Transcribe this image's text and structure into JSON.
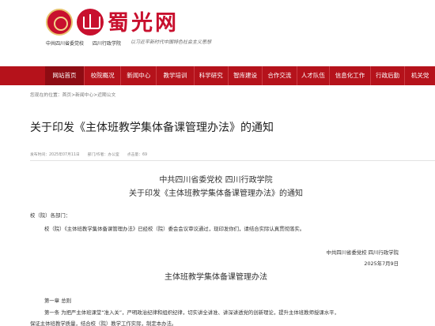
{
  "header": {
    "brand": "蜀光网",
    "sub_left": "中共四川省委党校",
    "sub_right": "四川行政学院",
    "slogan": "以习近平新时代中国特色社会主义思想"
  },
  "nav": {
    "items": [
      {
        "label": "网站首页",
        "active": true
      },
      {
        "label": "校院概况",
        "active": false
      },
      {
        "label": "新闻中心",
        "active": false
      },
      {
        "label": "教学培训",
        "active": false
      },
      {
        "label": "科学研究",
        "active": false
      },
      {
        "label": "智库建设",
        "active": false
      },
      {
        "label": "合作交流",
        "active": false
      },
      {
        "label": "人才队伍",
        "active": false
      },
      {
        "label": "信息化工作",
        "active": false
      },
      {
        "label": "行政后勤",
        "active": false
      },
      {
        "label": "机关党",
        "active": false
      }
    ]
  },
  "breadcrumb": {
    "prefix": "您现在的位置：",
    "home": "首页",
    "sep1": ">",
    "section": "新闻中心",
    "sep2": ">",
    "current": "近期公文"
  },
  "article": {
    "title": "关于印发《主体班教学集体备课管理办法》的通知",
    "meta": {
      "published": "发布时间：2025年07月11日",
      "dept": "部门/作者：办公室",
      "views": "点击量：69"
    },
    "body": {
      "org_line": "中共四川省委党校 四川行政学院",
      "notice_title": "关于印发《主体班教学集体备课管理办法》的通知",
      "salutation": "校（院）各部门：",
      "para1": "校（院）《主体班教学集体备课管理办法》已经校（院）委会会议审议通过，现印发你们，请结合实际认真贯彻落实。",
      "signature_org": "中共四川省委党校 四川行政学院",
      "signature_date": "2025年7月9日",
      "doc_title": "主体班教学集体备课管理办法",
      "chapter1": "第一章  总则",
      "art1_line1": "第一条  为把严主体班课堂“准入关”，严明政治纪律和组织纪律，切实讲全讲准、讲深讲透党的创新理论，提升主体班教师授课水平，",
      "art1_line2": "保证主体班教学质量，结合校（院）教学工作实际，制定本办法。"
    }
  },
  "colors": {
    "brand_red": "#c8102e",
    "nav_red": "#b5121b",
    "nav_active": "#8e0c13"
  }
}
